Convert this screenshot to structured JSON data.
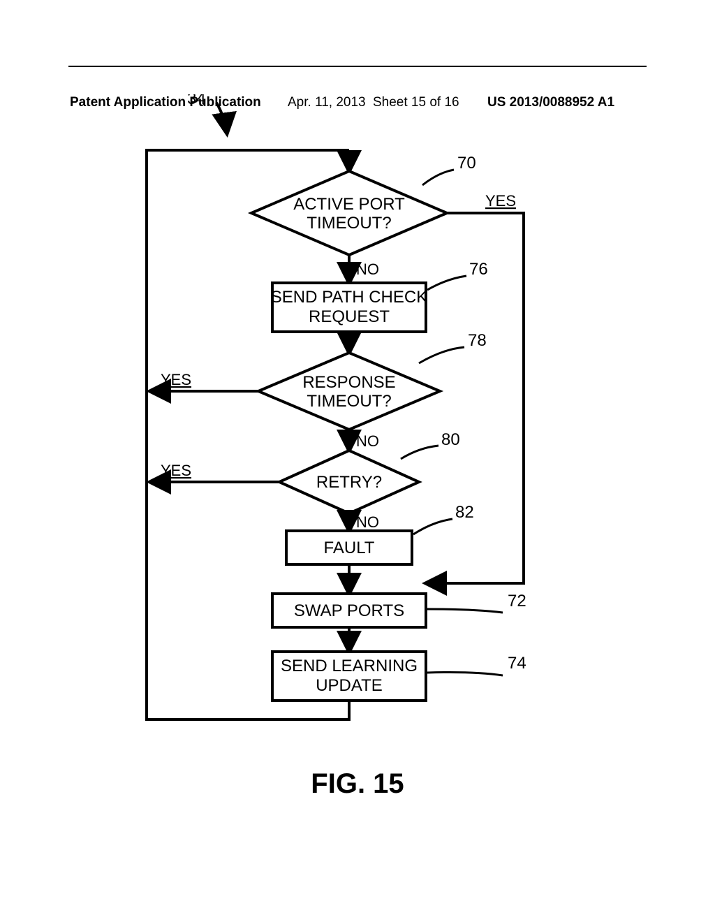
{
  "header": {
    "publication": "Patent Application Publication",
    "date": "Apr. 11, 2013",
    "sheet": "Sheet 15 of 16",
    "pubno": "US 2013/0088952 A1"
  },
  "entry_ref": "34",
  "nodes": {
    "d70": {
      "l1": "ACTIVE PORT",
      "l2": "TIMEOUT?",
      "ref": "70"
    },
    "b76": {
      "l1": "SEND PATH CHECK",
      "l2": "REQUEST",
      "ref": "76"
    },
    "d78": {
      "l1": "RESPONSE",
      "l2": "TIMEOUT?",
      "ref": "78"
    },
    "d80": {
      "l1": "RETRY?",
      "ref": "80"
    },
    "b82": {
      "l1": "FAULT",
      "ref": "82"
    },
    "b72": {
      "l1": "SWAP PORTS",
      "ref": "72"
    },
    "b74": {
      "l1": "SEND LEARNING",
      "l2": "UPDATE",
      "ref": "74"
    }
  },
  "edges": {
    "yes": "YES",
    "no": "NO"
  },
  "figure": "FIG. 15"
}
